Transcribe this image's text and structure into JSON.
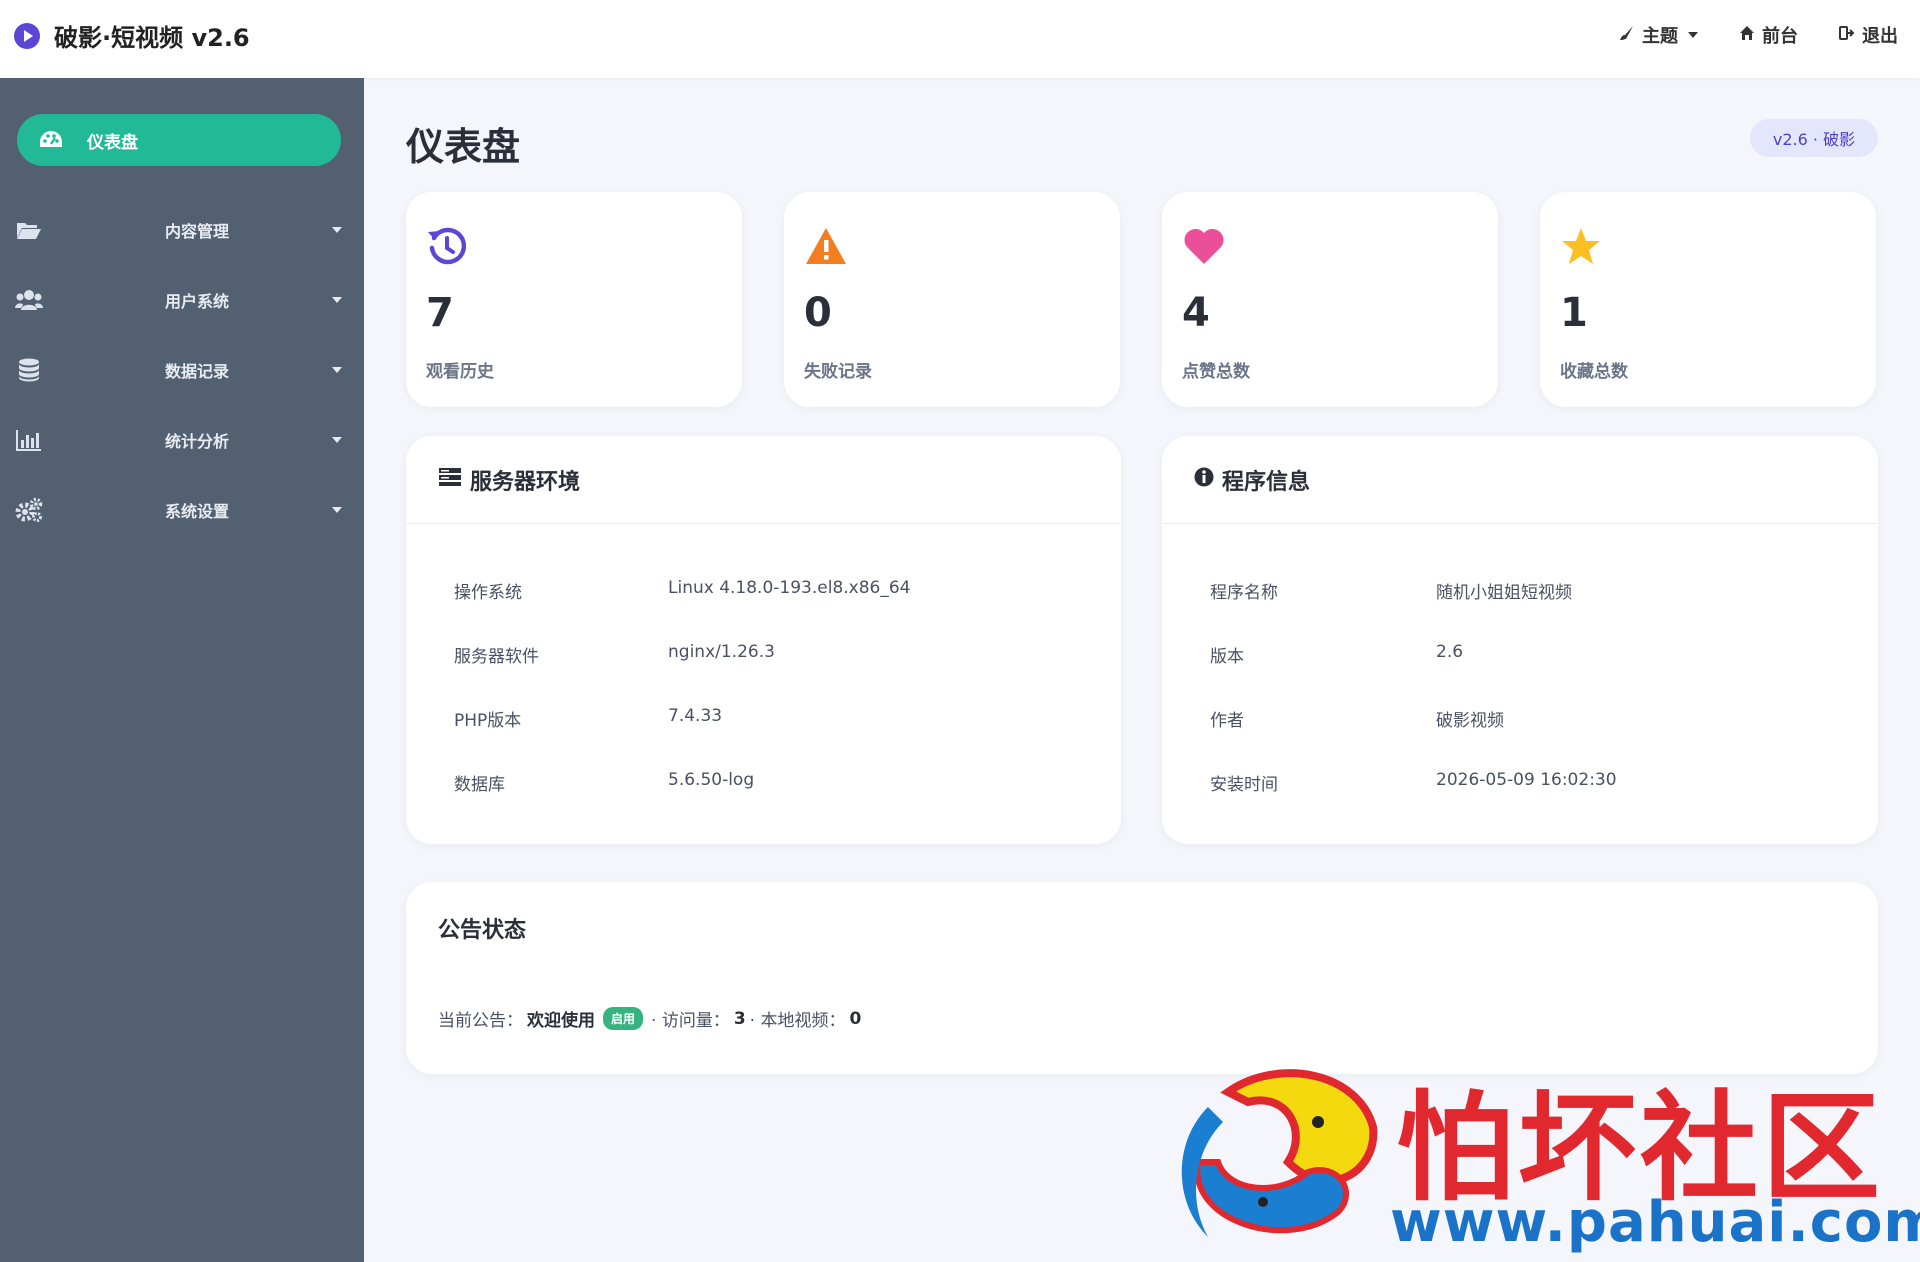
{
  "header": {
    "brand_title": "破影·短视频 v2.6",
    "actions": [
      {
        "label": "主题",
        "icon": "brush-icon"
      },
      {
        "label": "前台",
        "icon": "home-icon"
      },
      {
        "label": "退出",
        "icon": "logout-icon"
      }
    ]
  },
  "sidebar": {
    "active": {
      "label": "仪表盘",
      "icon": "dashboard-icon"
    },
    "items": [
      {
        "label": "内容管理",
        "icon": "folder-open-icon"
      },
      {
        "label": "用户系统",
        "icon": "users-icon"
      },
      {
        "label": "数据记录",
        "icon": "database-icon"
      },
      {
        "label": "统计分析",
        "icon": "bar-chart-icon"
      },
      {
        "label": "系统设置",
        "icon": "cogs-icon"
      }
    ]
  },
  "main": {
    "title": "仪表盘",
    "version_badge": "v2.6 · 破影",
    "stats": [
      {
        "value": "7",
        "label": "观看历史",
        "icon": "history-icon",
        "color": "#5b46d6"
      },
      {
        "value": "0",
        "label": "失败记录",
        "icon": "warning-icon",
        "color": "#f47d20"
      },
      {
        "value": "4",
        "label": "点赞总数",
        "icon": "heart-icon",
        "color": "#ec4f9a"
      },
      {
        "value": "1",
        "label": "收藏总数",
        "icon": "star-icon",
        "color": "#fbbf24"
      }
    ],
    "server_env": {
      "title": "服务器环境",
      "rows": [
        {
          "key": "操作系统",
          "value": "Linux 4.18.0-193.el8.x86_64"
        },
        {
          "key": "服务器软件",
          "value": "nginx/1.26.3"
        },
        {
          "key": "PHP版本",
          "value": "7.4.33"
        },
        {
          "key": "数据库",
          "value": "5.6.50-log"
        }
      ]
    },
    "program_info": {
      "title": "程序信息",
      "rows": [
        {
          "key": "程序名称",
          "value": "随机小姐姐短视频"
        },
        {
          "key": "版本",
          "value": "2.6"
        },
        {
          "key": "作者",
          "value": "破影视频"
        },
        {
          "key": "安装时间",
          "value": "2026-05-09 16:02:30"
        }
      ]
    },
    "notice": {
      "title": "公告状态",
      "prefix": "当前公告：",
      "current": "欢迎使用",
      "status": "启用",
      "visits_label": "· 访问量：",
      "visits": "3",
      "local_label": "· 本地视频：",
      "local_videos": "0"
    }
  },
  "watermark": {
    "name": "怕坏社区",
    "url": "www.pahuai.com"
  },
  "colors": {
    "sidebar_bg": "#526072",
    "active_nav": "#22b996",
    "accent": "#5b46d6"
  }
}
